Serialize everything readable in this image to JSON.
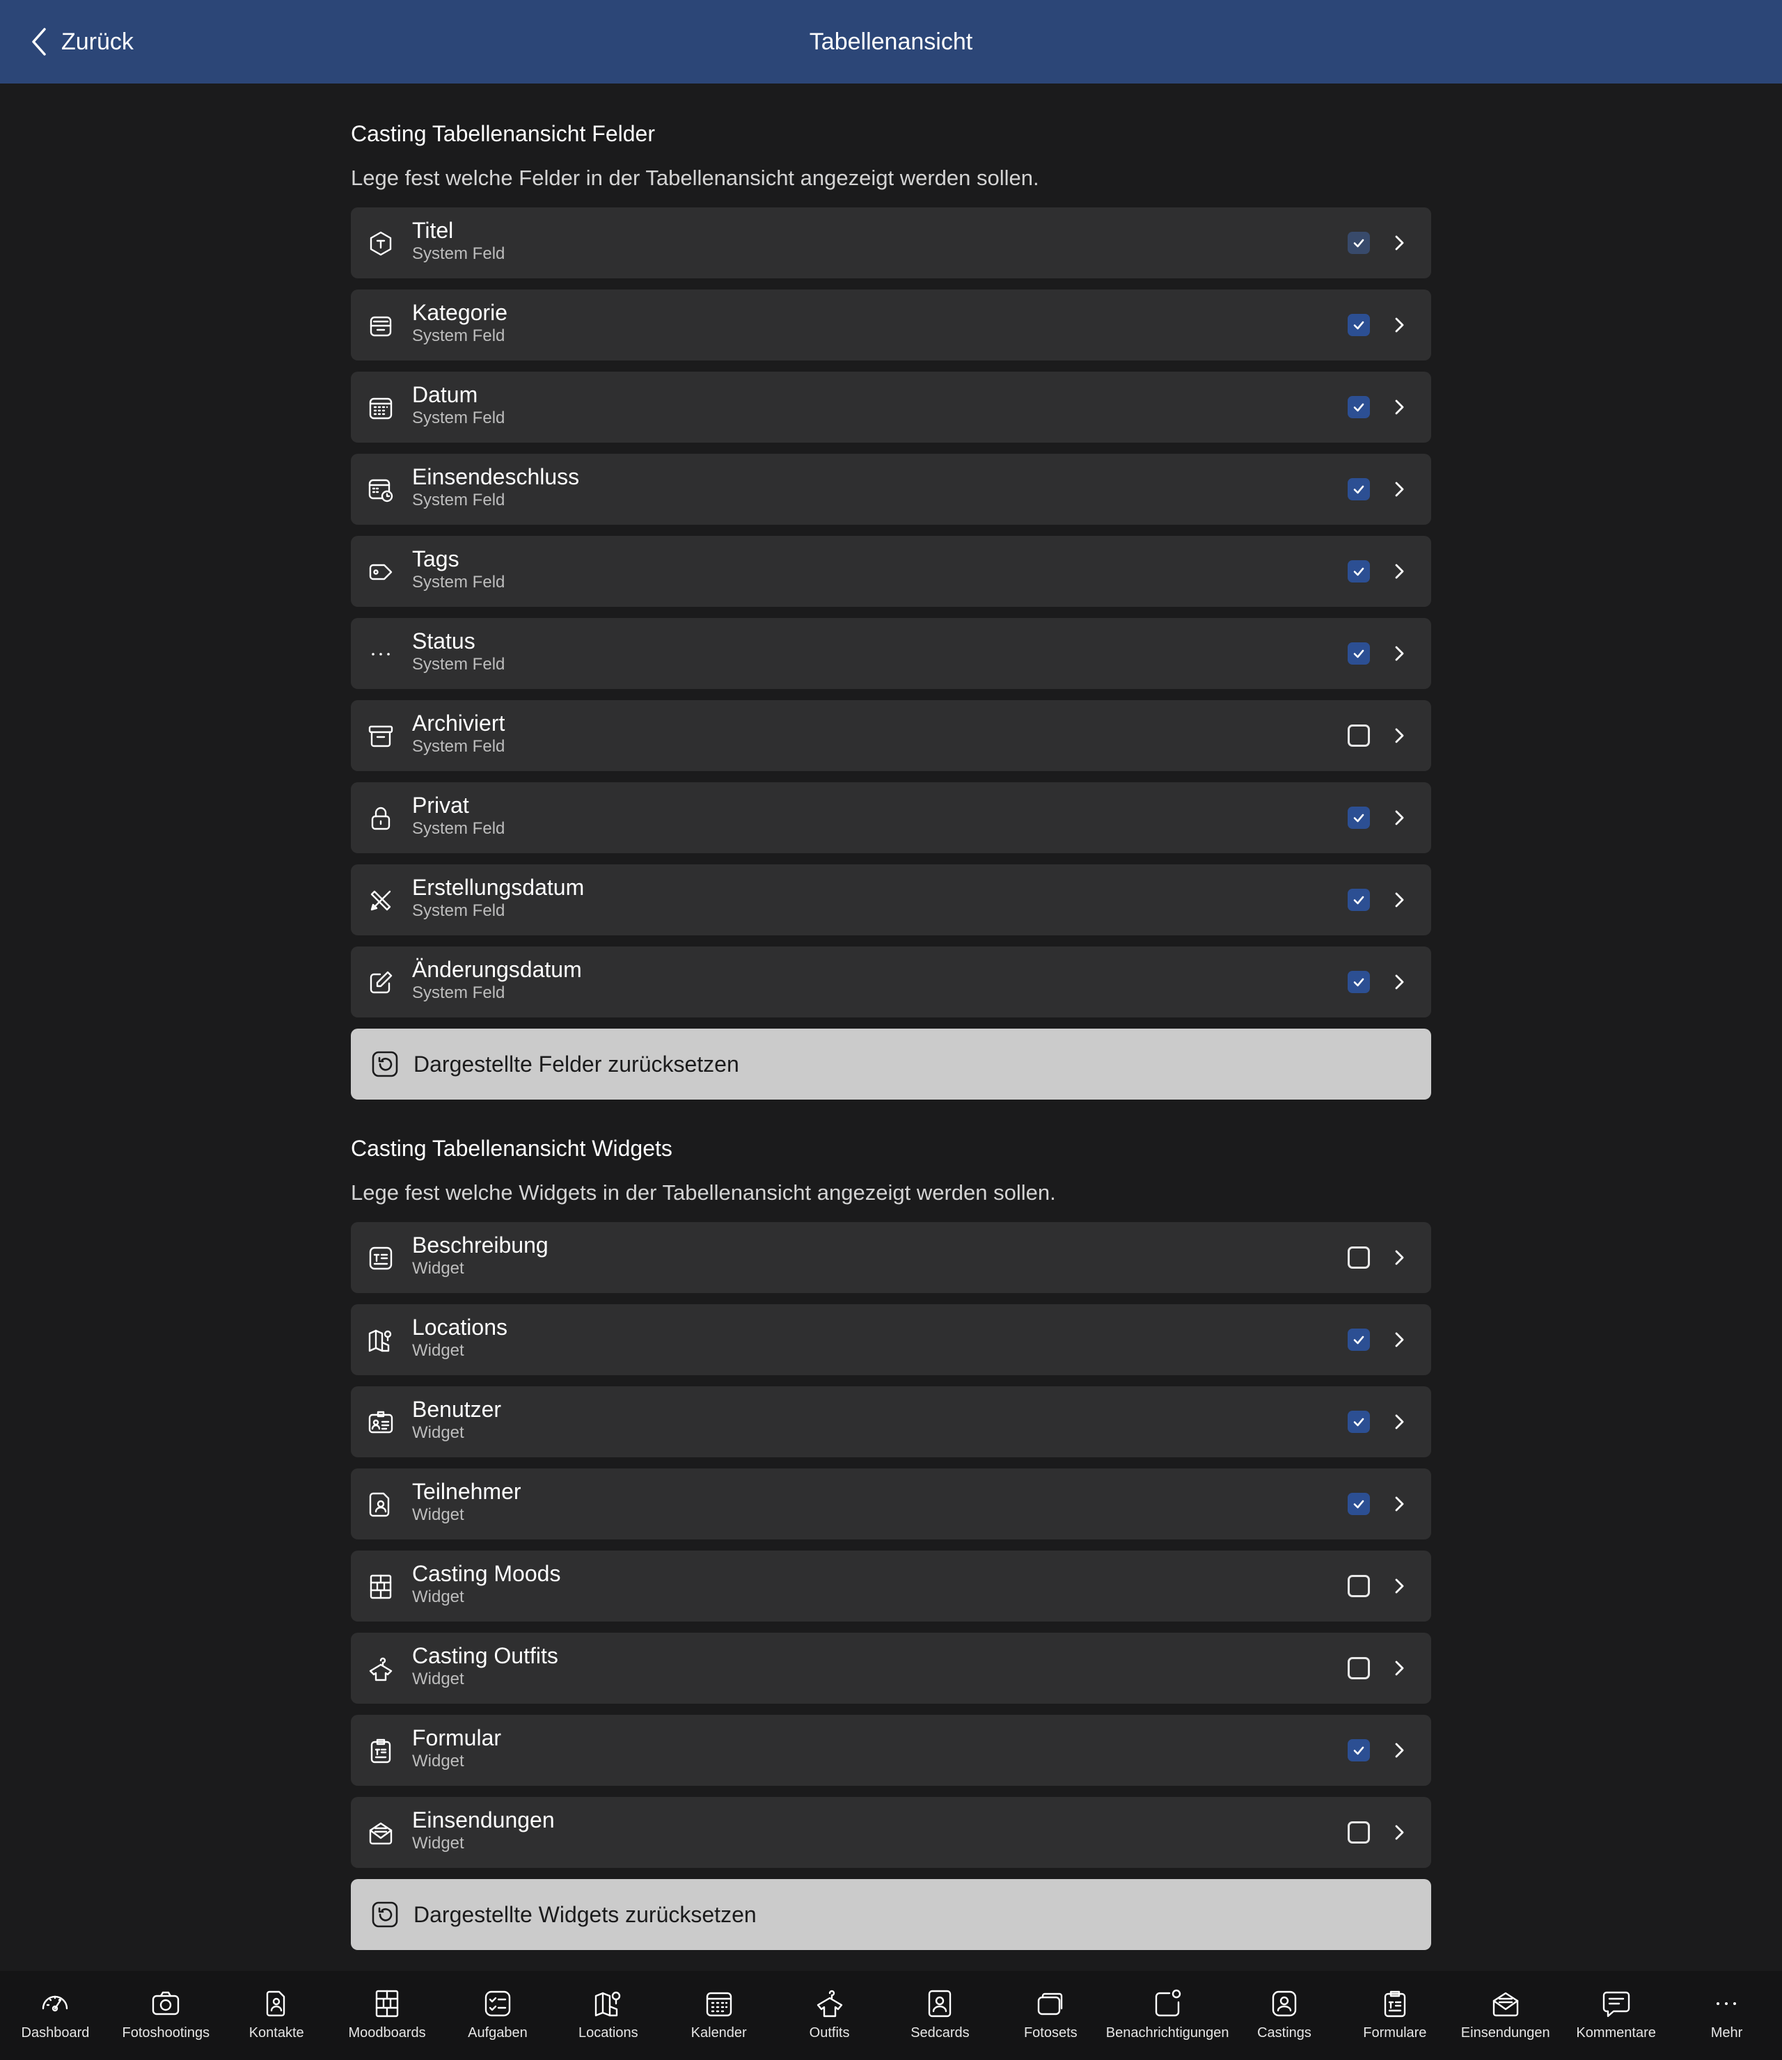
{
  "header": {
    "back_label": "Zurück",
    "title": "Tabellenansicht"
  },
  "fields_section": {
    "title": "Casting Tabellenansicht Felder",
    "description": "Lege fest welche Felder in der Tabellenansicht angezeigt werden sollen.",
    "items": [
      {
        "label": "Titel",
        "sub": "System Feld",
        "icon": "tag-shield-icon",
        "checked": true,
        "dim": true
      },
      {
        "label": "Kategorie",
        "sub": "System Feld",
        "icon": "inbox-tray-icon",
        "checked": true
      },
      {
        "label": "Datum",
        "sub": "System Feld",
        "icon": "calendar-icon",
        "checked": true
      },
      {
        "label": "Einsendeschluss",
        "sub": "System Feld",
        "icon": "calendar-clock-icon",
        "checked": true
      },
      {
        "label": "Tags",
        "sub": "System Feld",
        "icon": "tag-icon",
        "checked": true
      },
      {
        "label": "Status",
        "sub": "System Feld",
        "icon": "dots-icon",
        "checked": true
      },
      {
        "label": "Archiviert",
        "sub": "System Feld",
        "icon": "archive-box-icon",
        "checked": false
      },
      {
        "label": "Privat",
        "sub": "System Feld",
        "icon": "lock-icon",
        "checked": true
      },
      {
        "label": "Erstellungsdatum",
        "sub": "System Feld",
        "icon": "pencil-ruler-icon",
        "checked": true
      },
      {
        "label": "Änderungsdatum",
        "sub": "System Feld",
        "icon": "edit-square-icon",
        "checked": true
      }
    ],
    "reset_label": "Dargestellte Felder zurücksetzen"
  },
  "widgets_section": {
    "title": "Casting Tabellenansicht Widgets",
    "description": "Lege fest welche Widgets in der Tabellenansicht angezeigt werden sollen.",
    "items": [
      {
        "label": "Beschreibung",
        "sub": "Widget",
        "icon": "text-box-icon",
        "checked": false
      },
      {
        "label": "Locations",
        "sub": "Widget",
        "icon": "map-pin-icon",
        "checked": true
      },
      {
        "label": "Benutzer",
        "sub": "Widget",
        "icon": "id-card-icon",
        "checked": true
      },
      {
        "label": "Teilnehmer",
        "sub": "Widget",
        "icon": "contact-file-icon",
        "checked": true
      },
      {
        "label": "Casting Moods",
        "sub": "Widget",
        "icon": "moodboard-grid-icon",
        "checked": false
      },
      {
        "label": "Casting Outfits",
        "sub": "Widget",
        "icon": "shirt-hanger-icon",
        "checked": false
      },
      {
        "label": "Formular",
        "sub": "Widget",
        "icon": "clipboard-form-icon",
        "checked": true
      },
      {
        "label": "Einsendungen",
        "sub": "Widget",
        "icon": "mail-open-icon",
        "checked": false
      }
    ],
    "reset_label": "Dargestellte Widgets zurücksetzen"
  },
  "bottom_nav": [
    {
      "label": "Dashboard",
      "icon": "gauge-icon"
    },
    {
      "label": "Fotoshootings",
      "icon": "camera-icon"
    },
    {
      "label": "Kontakte",
      "icon": "contact-icon"
    },
    {
      "label": "Moodboards",
      "icon": "moodboard-icon"
    },
    {
      "label": "Aufgaben",
      "icon": "tasks-icon"
    },
    {
      "label": "Locations",
      "icon": "map-icon"
    },
    {
      "label": "Kalender",
      "icon": "calendar-icon"
    },
    {
      "label": "Outfits",
      "icon": "shirt-icon"
    },
    {
      "label": "Sedcards",
      "icon": "sedcard-icon"
    },
    {
      "label": "Fotosets",
      "icon": "photosets-icon"
    },
    {
      "label": "Benachrichtigungen",
      "icon": "notification-icon"
    },
    {
      "label": "Castings",
      "icon": "castings-icon"
    },
    {
      "label": "Formulare",
      "icon": "forms-icon"
    },
    {
      "label": "Einsendungen",
      "icon": "submissions-icon"
    },
    {
      "label": "Kommentare",
      "icon": "comment-icon"
    },
    {
      "label": "Mehr",
      "icon": "more-icon"
    }
  ],
  "colors": {
    "header_bg": "#2c4677",
    "page_bg": "#1b1b1c",
    "row_bg": "#2f2f30",
    "checkbox_on": "#2c4f93",
    "reset_button_bg": "#cbcbcb",
    "bottom_nav_bg": "#141415"
  }
}
